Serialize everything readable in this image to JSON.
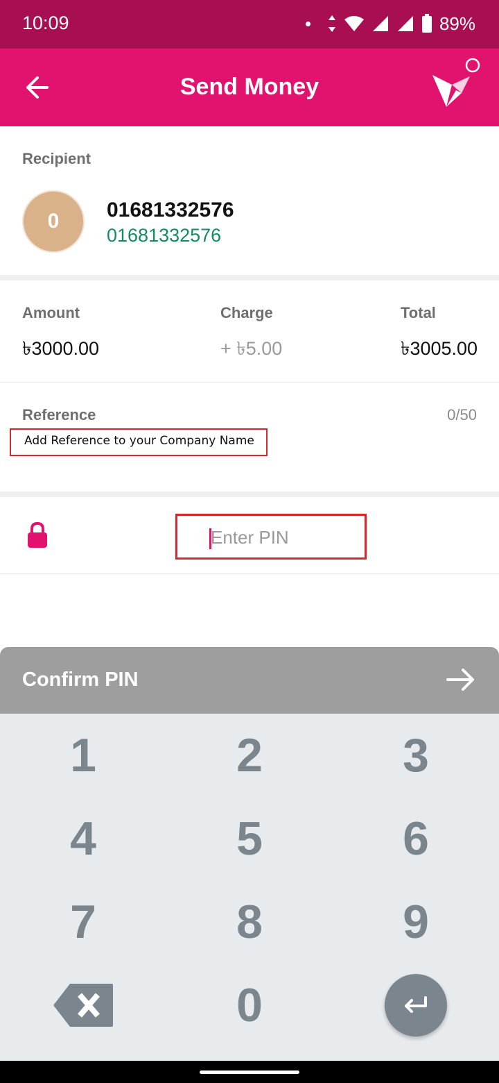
{
  "status_bar": {
    "time": "10:09",
    "battery": "89%"
  },
  "app_bar": {
    "title": "Send Money"
  },
  "recipient": {
    "label": "Recipient",
    "avatar_initial": "0",
    "name": "01681332576",
    "number": "01681332576"
  },
  "amounts": {
    "amount_label": "Amount",
    "amount_value": "৳3000.00",
    "charge_label": "Charge",
    "charge_value": "+ ৳5.00",
    "total_label": "Total",
    "total_value": "৳3005.00"
  },
  "reference": {
    "label": "Reference",
    "counter": "0/50",
    "annotation": "Add Reference to your Company Name"
  },
  "pin": {
    "placeholder": "Enter PIN"
  },
  "confirm": {
    "label": "Confirm PIN"
  },
  "keypad": {
    "keys": [
      "1",
      "2",
      "3",
      "4",
      "5",
      "6",
      "7",
      "8",
      "9",
      "0"
    ]
  },
  "colors": {
    "brand": "#e2136e",
    "status_bar": "#a80f52",
    "annotation_border": "#d7262d",
    "confirm_bar": "#9e9e9e",
    "keypad_bg": "#e8ebed",
    "key_text": "#7b858e"
  },
  "icons": {
    "back": "arrow-left-icon",
    "logo": "bird-logo-icon",
    "lock": "lock-icon",
    "confirm": "arrow-right-icon",
    "backspace": "backspace-icon",
    "enter": "enter-icon"
  }
}
